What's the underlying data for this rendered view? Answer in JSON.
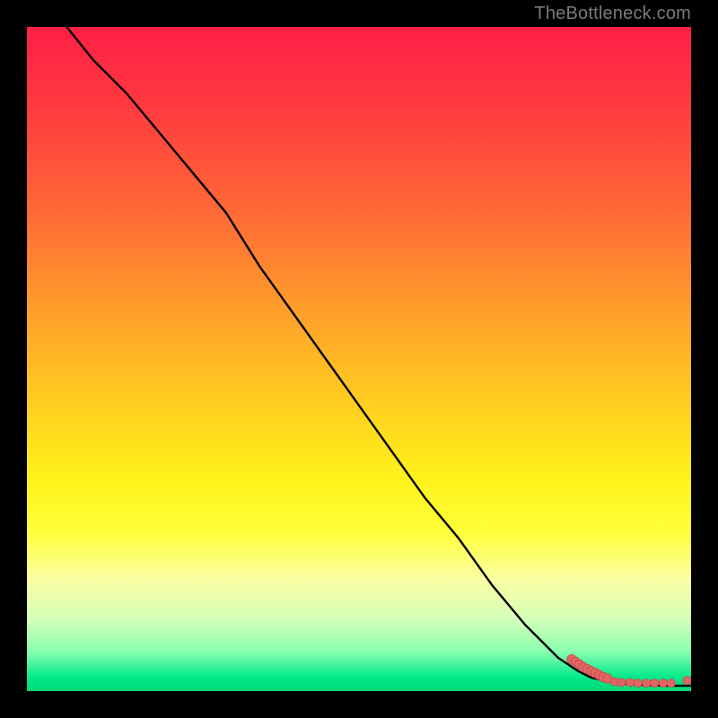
{
  "watermark": "TheBottleneck.com",
  "colors": {
    "curve": "#000000",
    "dot_fill": "#e06666",
    "dot_stroke": "#d04848"
  },
  "chart_data": {
    "type": "line",
    "title": "",
    "xlabel": "",
    "ylabel": "",
    "xlim": [
      0,
      100
    ],
    "ylim": [
      0,
      100
    ],
    "grid": false,
    "series": [
      {
        "name": "curve",
        "kind": "line",
        "x": [
          6,
          10,
          15,
          20,
          25,
          30,
          35,
          40,
          45,
          50,
          55,
          60,
          65,
          70,
          75,
          80,
          83,
          85,
          88,
          90,
          93,
          96,
          100
        ],
        "y": [
          100,
          95,
          90,
          84,
          78,
          72,
          64,
          57,
          50,
          43,
          36,
          29,
          23,
          16,
          10,
          5,
          3,
          2,
          1.4,
          1.1,
          0.9,
          0.8,
          0.8
        ]
      },
      {
        "name": "dots-cluster",
        "kind": "scatter",
        "x": [
          82.0,
          82.6,
          83.2,
          83.8,
          84.4,
          85.0,
          85.6,
          86.2,
          86.8,
          87.4
        ],
        "y": [
          4.8,
          4.4,
          4.0,
          3.6,
          3.3,
          3.0,
          2.7,
          2.4,
          2.1,
          1.9
        ]
      },
      {
        "name": "dots-tail",
        "kind": "scatter",
        "x": [
          88.5,
          89.5,
          90.8,
          92.0,
          93.3,
          94.5,
          95.8,
          97.0,
          99.4
        ],
        "y": [
          1.4,
          1.3,
          1.3,
          1.2,
          1.2,
          1.2,
          1.2,
          1.2,
          1.6
        ]
      }
    ]
  }
}
